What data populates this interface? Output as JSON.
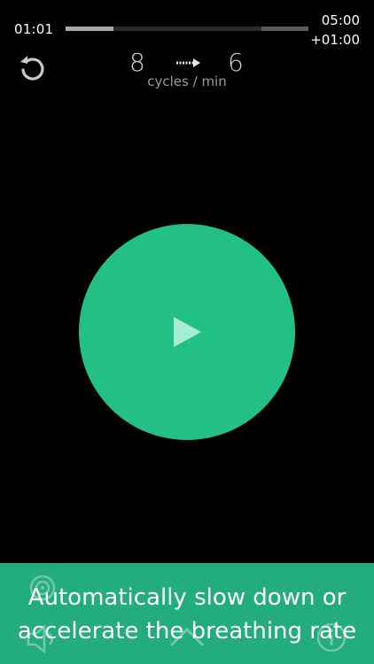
{
  "timer": {
    "elapsed": "01:01",
    "total": "05:00",
    "extension": "+01:00",
    "progress": 0.2
  },
  "icons": {
    "restart": "restart-icon",
    "arrow": "arrow-right-icon",
    "play": "play-icon",
    "target": "target-icon",
    "sound": "speaker-icon",
    "collapse": "chevron-up-icon",
    "info": "info-icon"
  },
  "cycles": {
    "from": "8",
    "to": "6",
    "unit": "cycles / min"
  },
  "banner": {
    "line1": "Automatically slow down or",
    "line2": "accelerate the breathing rate"
  },
  "colors": {
    "accent": "#22c087",
    "banner": "#23ad7c",
    "background": "#000000"
  }
}
